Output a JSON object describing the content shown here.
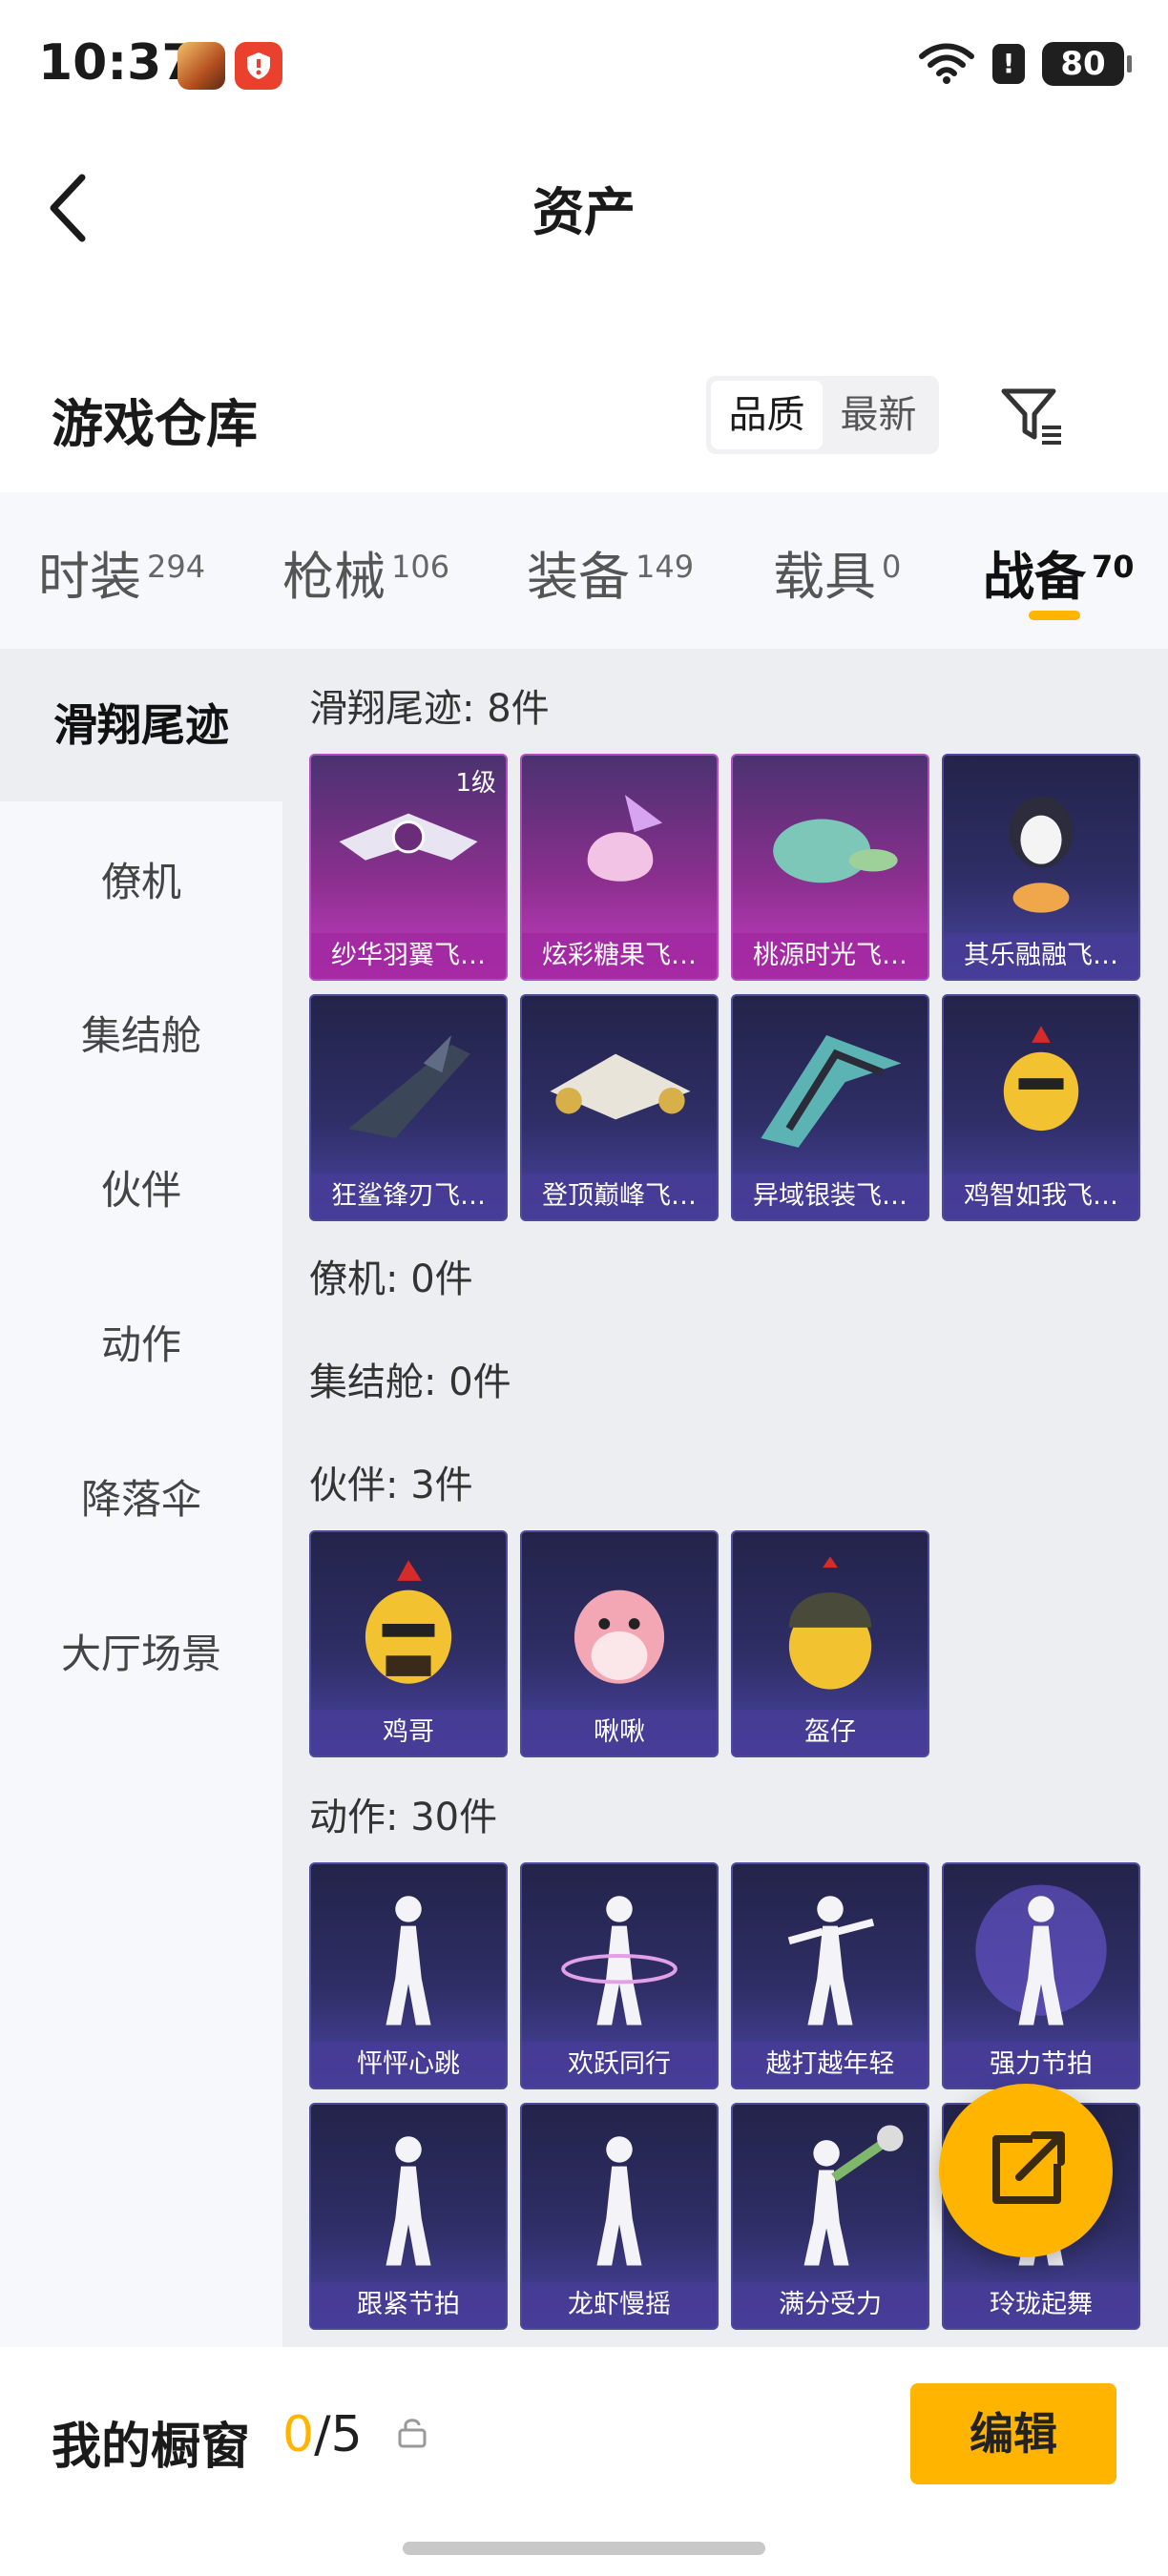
{
  "status_bar": {
    "time": "10:37",
    "battery": "80",
    "alert": "!"
  },
  "header": {
    "title": "资产"
  },
  "warehouse": {
    "title": "游戏仓库",
    "sort_options": [
      "品质",
      "最新"
    ]
  },
  "tabs": [
    {
      "label": "时装",
      "count": "294"
    },
    {
      "label": "枪械",
      "count": "106"
    },
    {
      "label": "装备",
      "count": "149"
    },
    {
      "label": "载具",
      "count": "0"
    },
    {
      "label": "战备",
      "count": "70"
    }
  ],
  "sidebar": {
    "items": [
      {
        "label": "滑翔尾迹"
      },
      {
        "label": "僚机"
      },
      {
        "label": "集结舱"
      },
      {
        "label": "伙伴"
      },
      {
        "label": "动作"
      },
      {
        "label": "降落伞"
      },
      {
        "label": "大厅场景"
      }
    ]
  },
  "sections": {
    "trails": {
      "title": "滑翔尾迹: 8件",
      "level_badge": "1级",
      "items": [
        "纱华羽翼飞…",
        "炫彩糖果飞…",
        "桃源时光飞…",
        "其乐融融飞…",
        "狂鲨锋刃飞…",
        "登顶巅峰飞…",
        "异域银装飞…",
        "鸡智如我飞…"
      ]
    },
    "wingman": {
      "title": "僚机: 0件"
    },
    "capsule": {
      "title": "集结舱: 0件"
    },
    "partners": {
      "title": "伙伴: 3件",
      "items": [
        "鸡哥",
        "啾啾",
        "盔仔"
      ]
    },
    "emotes": {
      "title": "动作: 30件",
      "items": [
        "怦怦心跳",
        "欢跃同行",
        "越打越年轻",
        "强力节拍",
        "跟紧节拍",
        "龙虾慢摇",
        "满分受力",
        "玲珑起舞"
      ]
    }
  },
  "showcase": {
    "label": "我的橱窗",
    "current": "0",
    "total": "/5",
    "edit_label": "编辑"
  },
  "colors": {
    "accent": "#ffb400",
    "purple_card": "#c53cc0",
    "blue_card": "#2f2e66"
  }
}
